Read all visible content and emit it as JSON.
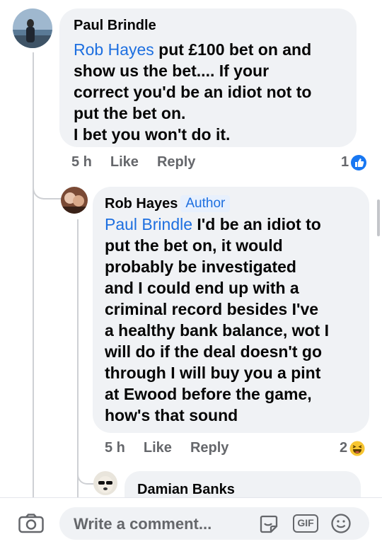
{
  "comments": [
    {
      "author": "Paul Brindle",
      "mention": "Rob Hayes",
      "text_lines": [
        " put £100 bet on and",
        "show us the bet.... If your",
        "correct you'd be an idiot not to",
        "put the bet on.",
        "I bet you won't do it."
      ],
      "time": "5 h",
      "like_label": "Like",
      "reply_label": "Reply",
      "reaction_count": "1",
      "reaction_icon": "like-reaction-icon"
    },
    {
      "author": "Rob Hayes",
      "badge": "Author",
      "mention": "Paul Brindle",
      "text_lines": [
        " I'd be an idiot to",
        "put the bet on, it would",
        "probably be investigated",
        "and I could end up with a",
        "criminal record besides I've",
        "a healthy bank balance, wot I",
        "will do if the deal doesn't go",
        "through I will buy you a pint",
        "at Ewood before the game,",
        "how's that sound"
      ],
      "time": "5 h",
      "like_label": "Like",
      "reply_label": "Reply",
      "reaction_count": "2",
      "reaction_icon": "haha-reaction-icon"
    },
    {
      "author": "Damian Banks"
    }
  ],
  "composer": {
    "placeholder": "Write a comment...",
    "gif_label": "GIF"
  },
  "colors": {
    "accent": "#1d6fe0",
    "bubble": "#f0f2f5",
    "meta": "#65676b"
  }
}
